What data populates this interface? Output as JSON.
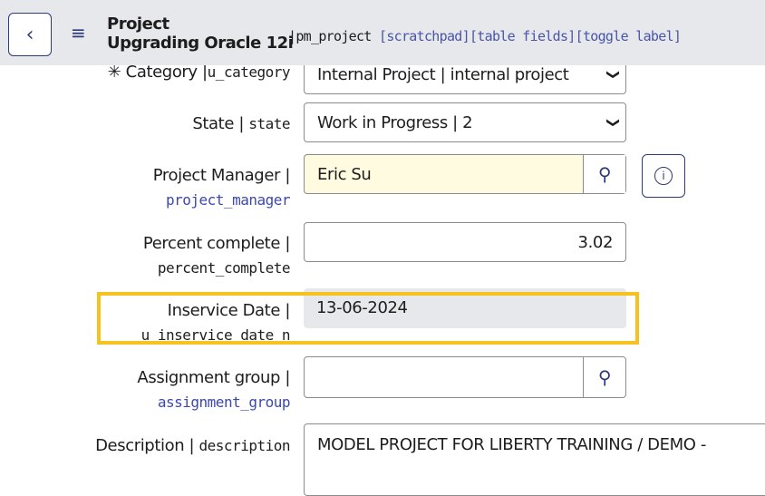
{
  "header": {
    "back": "‹",
    "menu": "≡",
    "title_line1": "Project",
    "title_line2": "Upgrading Oracle 12i",
    "table": "|pm_project ",
    "links": [
      "[scratchpad]",
      "[table fields]",
      "[toggle label]"
    ]
  },
  "fields": [
    {
      "label": "Category |",
      "name": "u_category",
      "value": "Internal Project | internal project",
      "mandatory": "✳"
    },
    {
      "label": "State |",
      "name": "state",
      "value": "Work in Progress | 2"
    },
    {
      "label": "Project Manager |",
      "name": "project_manager",
      "value": "Eric Su"
    },
    {
      "label": "Percent complete |",
      "name": "percent_complete",
      "value": "3.02"
    },
    {
      "label": "Inservice Date |",
      "name": "u_inservice_date_n",
      "value": "13-06-2024"
    },
    {
      "label": "Assignment group |",
      "name": "assignment_group",
      "value": ""
    },
    {
      "label": "Description |",
      "name": "description",
      "value": "MODEL PROJECT FOR LIBERTY TRAINING / DEMO -"
    }
  ],
  "colors": {
    "highlight": "#f5c220",
    "reference_bg": "#fefbe0",
    "readonly_bg": "#e6e8eb"
  }
}
